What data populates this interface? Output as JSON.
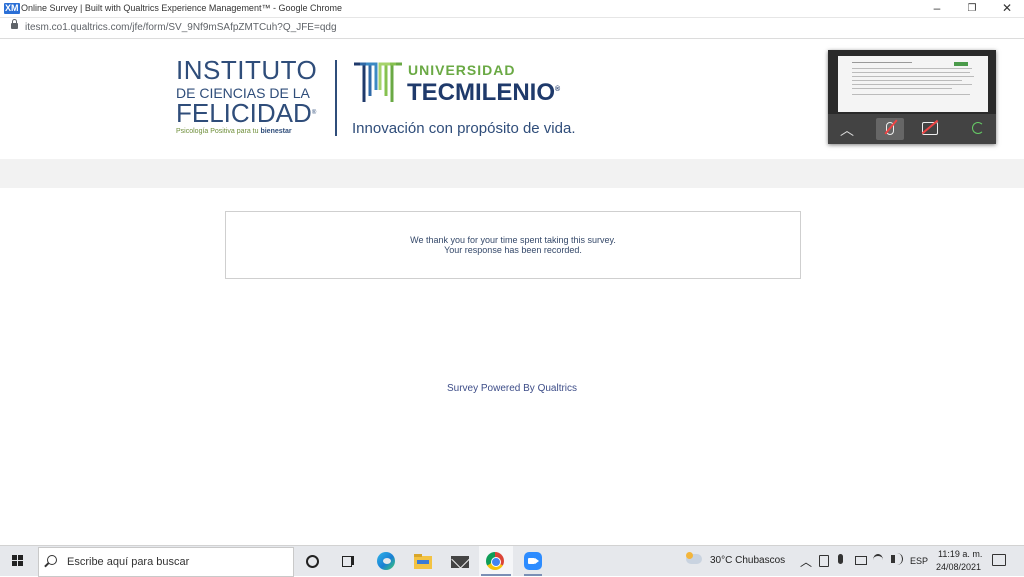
{
  "window": {
    "favicon_text": "XM",
    "title": "Online Survey | Built with Qualtrics Experience Management™ - Google Chrome",
    "minimize_glyph": "–",
    "restore_glyph": "❐",
    "close_glyph": "✕"
  },
  "addressbar": {
    "url": "itesm.co1.qualtrics.com/jfe/form/SV_9Nf9mSAfpZMTCuh?Q_JFE=qdg"
  },
  "header": {
    "instituto": {
      "line1": "INSTITUTO",
      "line2": "DE CIENCIAS DE LA",
      "line3": "FELICIDAD",
      "reg": "®",
      "tagline_prefix": "Psicología Positiva para tu",
      "tagline_bold": "bienestar"
    },
    "tecmilenio": {
      "universidad": "UNIVERSIDAD",
      "name": "TECMILENIO",
      "reg": "®",
      "slogan": "Innovación con propósito de vida."
    }
  },
  "survey": {
    "thanks_line1": "We thank you for your time spent taking this survey.",
    "thanks_line2": "Your response has been recorded.",
    "footer": "Survey Powered By Qualtrics"
  },
  "taskbar": {
    "search_placeholder": "Escribe aquí para buscar",
    "apps": [
      "cortana-icon",
      "task-view-icon",
      "edge-icon",
      "file-explorer-icon",
      "mail-icon",
      "chrome-icon",
      "zoom-icon"
    ],
    "weather": "30°C  Chubascos",
    "language": "ESP",
    "time": "11:19 a. m.",
    "date": "24/08/2021",
    "colors": {
      "accent": "#2f4d7a",
      "tec_green": "#6aa944",
      "tec_blue": "#1f3a6b"
    }
  }
}
